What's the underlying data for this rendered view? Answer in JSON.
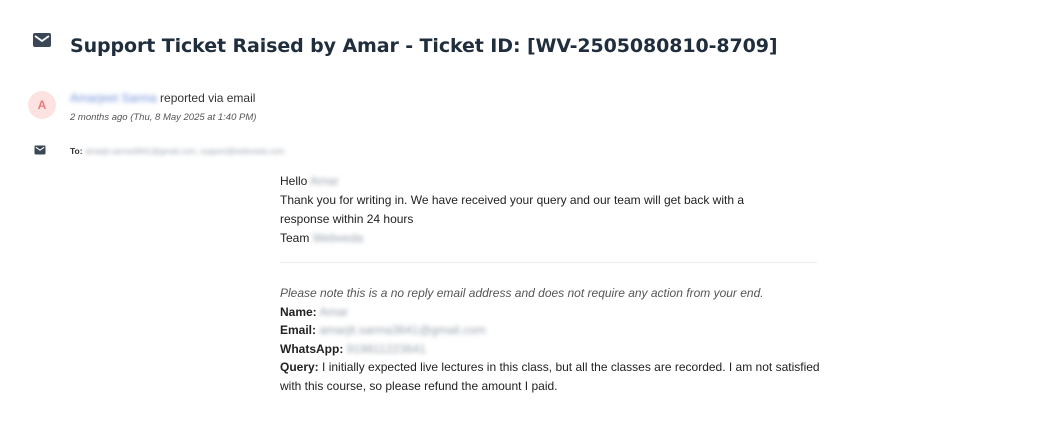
{
  "ticket": {
    "title": "Support Ticket Raised by Amar - Ticket ID: [WV-2505080810-8709]"
  },
  "sender": {
    "avatar_letter": "A",
    "name": "Amarjeet Sarma",
    "action": "reported via email",
    "timestamp": "2 months ago (Thu, 8 May 2025 at 1:40 PM)"
  },
  "recipients": {
    "label": "To:",
    "value": "amarjit.sarma3641@gmail.com, support@webveda.com"
  },
  "message": {
    "greeting": "Hello",
    "greeting_name": "Amar",
    "line1": "Thank you for writing in. We have received your query and our team will get back with a",
    "line2": "response within 24 hours",
    "signoff": "Team",
    "signoff_name": "Webveda"
  },
  "details": {
    "note": "Please note this is a no reply email address and does not require any action from your end.",
    "name_label": "Name:",
    "name_value": "Amar",
    "email_label": "Email:",
    "email_value": "amarjit.sarma3641@gmail.com",
    "whatsapp_label": "WhatsApp:",
    "whatsapp_value": "919811223641",
    "query_label": "Query:",
    "query_value": "I initially expected live lectures in this class, but all the classes are recorded. I am not satisfied with this course, so please refund the amount I paid."
  },
  "icons": {
    "header": "envelope-icon",
    "to": "envelope-icon"
  },
  "colors": {
    "title": "#1f2d3d",
    "avatar_bg": "#fde2e2",
    "avatar_fg": "#e77b7b",
    "link": "#6f8fd8"
  }
}
